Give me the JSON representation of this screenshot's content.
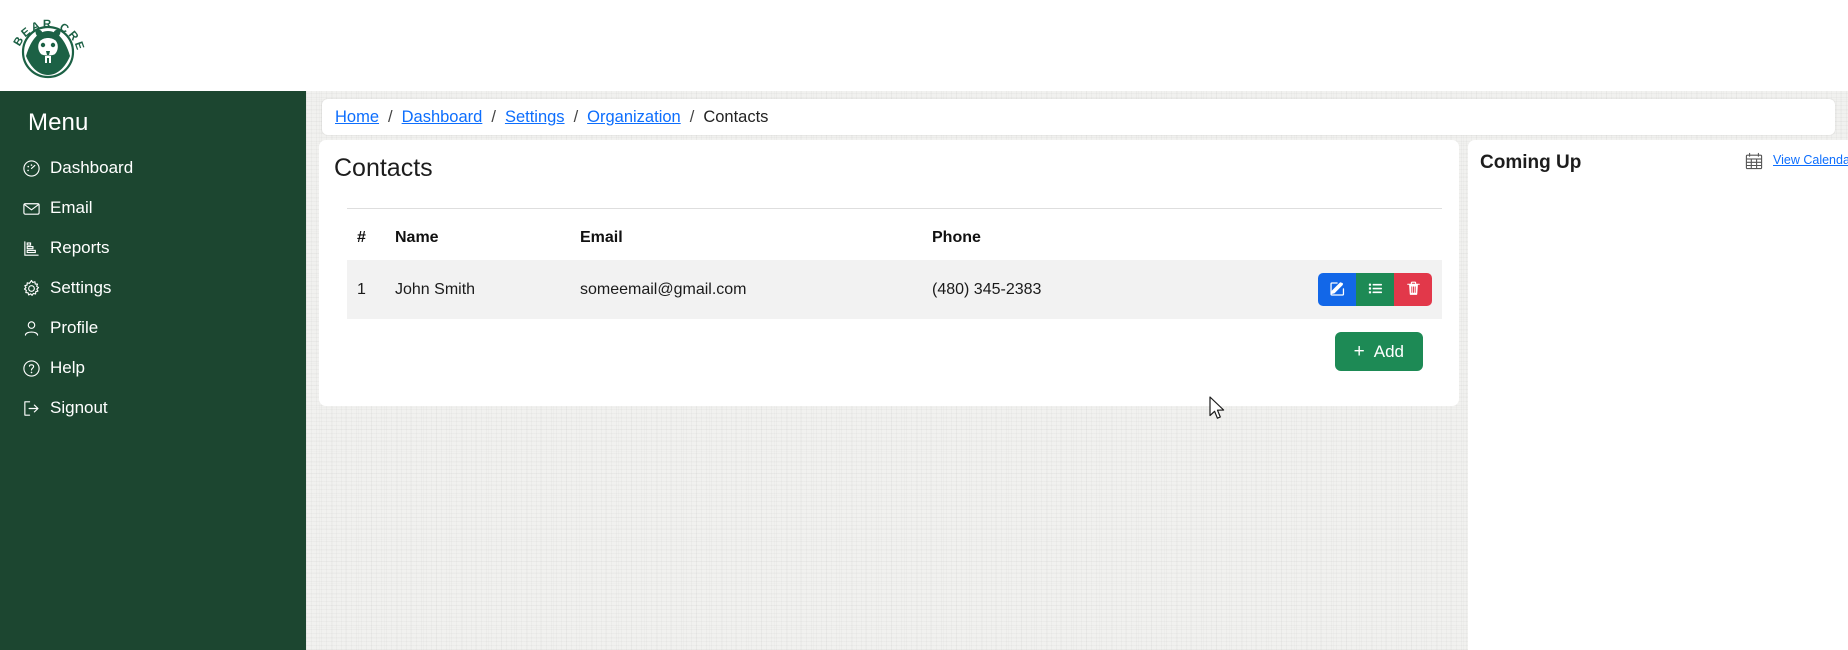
{
  "brand": {
    "logo_text_top": "BEAR CREEK",
    "logo_name": "bear-creek-logo",
    "primary_green": "#1c4630"
  },
  "sidebar": {
    "title": "Menu",
    "items": [
      {
        "label": "Dashboard",
        "icon": "gauge-icon"
      },
      {
        "label": "Email",
        "icon": "envelope-icon"
      },
      {
        "label": "Reports",
        "icon": "chart-bar-icon"
      },
      {
        "label": "Settings",
        "icon": "gear-icon"
      },
      {
        "label": "Profile",
        "icon": "user-icon"
      },
      {
        "label": "Help",
        "icon": "question-circle-icon"
      },
      {
        "label": "Signout",
        "icon": "signout-icon"
      }
    ]
  },
  "breadcrumb": {
    "separator": "/",
    "links": [
      "Home",
      "Dashboard",
      "Settings",
      "Organization"
    ],
    "current": "Contacts"
  },
  "main": {
    "title": "Contacts",
    "table": {
      "headers": [
        "#",
        "Name",
        "Email",
        "Phone"
      ],
      "rows": [
        {
          "num": "1",
          "name": "John Smith",
          "email": "someemail@gmail.com",
          "phone": "(480) 345-2383"
        }
      ]
    },
    "row_actions": [
      {
        "name": "edit-contact-button",
        "icon": "pencil-square-icon",
        "color": "#1267e8"
      },
      {
        "name": "list-contact-button",
        "icon": "list-icon",
        "color": "#1d8a55"
      },
      {
        "name": "delete-contact-button",
        "icon": "trash-icon",
        "color": "#e2384a"
      }
    ],
    "add_button": {
      "plus": "+",
      "label": "Add"
    }
  },
  "side_panel": {
    "title": "Coming Up",
    "view_calendar_label": "View Calendar",
    "calendar_icon": "calendar-icon"
  }
}
